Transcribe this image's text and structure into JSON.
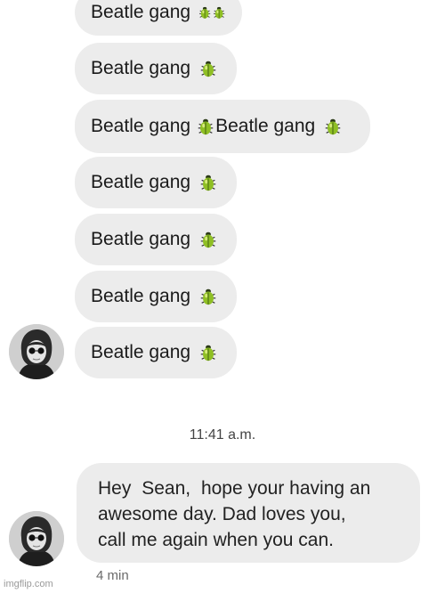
{
  "messages": [
    {
      "text": "Beatle gang",
      "emoji": "beetle",
      "count": 2
    },
    {
      "text": "Beatle gang",
      "emoji": "beetle",
      "count": 1
    },
    {
      "text": "Beatle gang",
      "text2": "Beatle gang",
      "emoji": "beetle",
      "count": 1
    },
    {
      "text": "Beatle gang",
      "emoji": "beetle",
      "count": 1
    },
    {
      "text": "Beatle gang",
      "emoji": "beetle",
      "count": 1
    },
    {
      "text": "Beatle gang",
      "emoji": "beetle",
      "count": 1
    },
    {
      "text": "Beatle gang",
      "emoji": "beetle",
      "count": 1
    }
  ],
  "timestamp": "11:41 a.m.",
  "final_message": {
    "prefix": "Hey",
    "name": "Sean,",
    "line1_rest": "hope your having an",
    "line2": "awesome day. Dad loves you,",
    "line3": "call me again when you can."
  },
  "time_ago": "4 min",
  "watermark": "imgflip.com",
  "avatar_icon": "john-lennon-avatar",
  "colors": {
    "bubble": "#ececec",
    "text": "#1a1a1a"
  }
}
